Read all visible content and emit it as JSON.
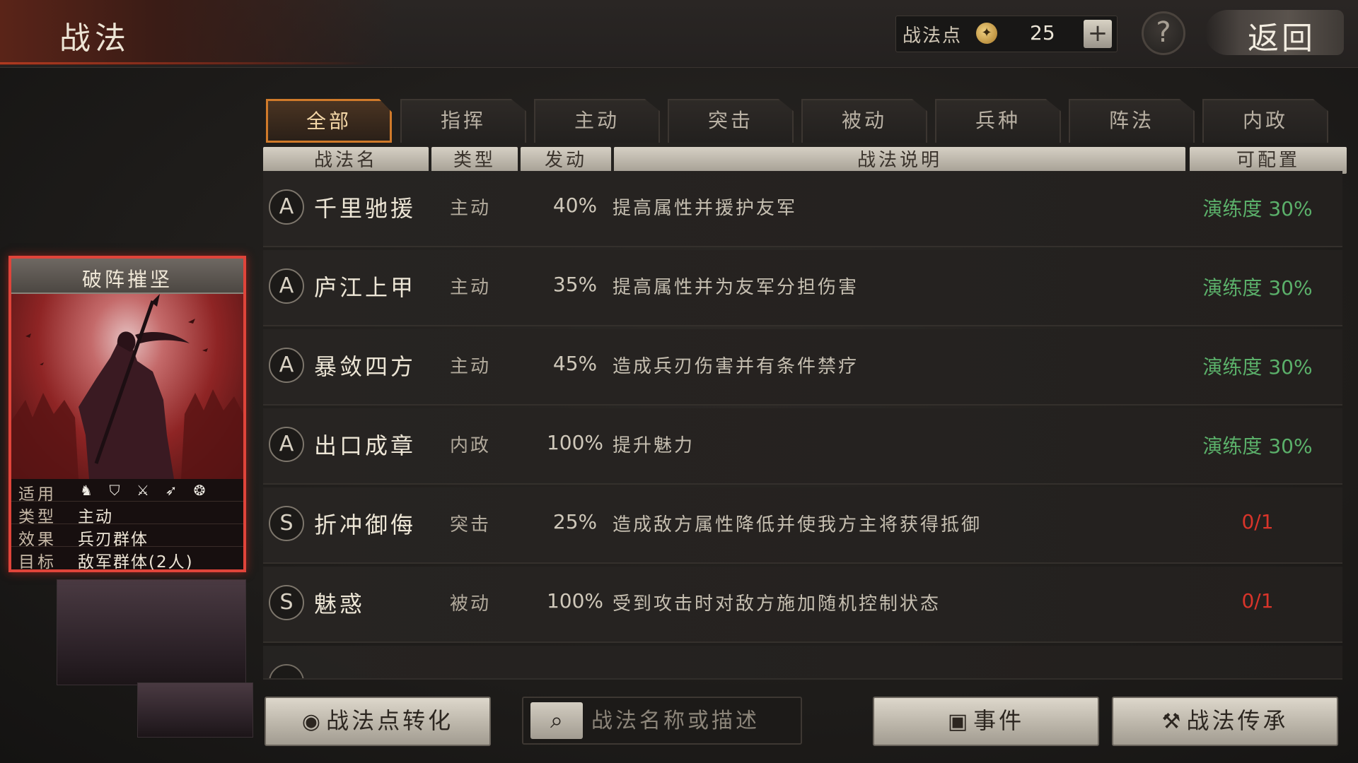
{
  "header": {
    "title": "战法",
    "points_label": "战法点",
    "points_value": "25",
    "plus_label": "+",
    "help_label": "?",
    "back_label": "返回"
  },
  "tabs": [
    {
      "label": "全部",
      "active": true
    },
    {
      "label": "指挥",
      "active": false
    },
    {
      "label": "主动",
      "active": false
    },
    {
      "label": "突击",
      "active": false
    },
    {
      "label": "被动",
      "active": false
    },
    {
      "label": "兵种",
      "active": false
    },
    {
      "label": "阵法",
      "active": false
    },
    {
      "label": "内政",
      "active": false
    }
  ],
  "columns": {
    "name": "战法名",
    "type": "类型",
    "rate": "发动",
    "desc": "战法说明",
    "config": "可配置"
  },
  "skills": [
    {
      "grade": "A",
      "name": "千里驰援",
      "type": "主动",
      "rate": "40%",
      "desc": "提高属性并援护友军",
      "status": "演练度 30%",
      "status_kind": "ok"
    },
    {
      "grade": "A",
      "name": "庐江上甲",
      "type": "主动",
      "rate": "35%",
      "desc": "提高属性并为友军分担伤害",
      "status": "演练度 30%",
      "status_kind": "ok"
    },
    {
      "grade": "A",
      "name": "暴敛四方",
      "type": "主动",
      "rate": "45%",
      "desc": "造成兵刃伤害并有条件禁疗",
      "status": "演练度 30%",
      "status_kind": "ok"
    },
    {
      "grade": "A",
      "name": "出口成章",
      "type": "内政",
      "rate": "100%",
      "desc": "提升魅力",
      "status": "演练度 30%",
      "status_kind": "ok"
    },
    {
      "grade": "S",
      "name": "折冲御侮",
      "type": "突击",
      "rate": "25%",
      "desc": "造成敌方属性降低并使我方主将获得抵御",
      "status": "0/1",
      "status_kind": "no"
    },
    {
      "grade": "S",
      "name": "魅惑",
      "type": "被动",
      "rate": "100%",
      "desc": "受到攻击时对敌方施加随机控制状态",
      "status": "0/1",
      "status_kind": "no"
    }
  ],
  "preview_card": {
    "title": "破阵摧坚",
    "applies_label": "适用",
    "troop_icons": [
      "cavalry-icon",
      "shield-icon",
      "crossed-swords-icon",
      "archer-icon",
      "siege-icon"
    ],
    "type_label": "类型",
    "type_value": "主动",
    "effect_label": "效果",
    "effect_value": "兵刃群体",
    "target_label": "目标",
    "target_value": "敌军群体(2人)"
  },
  "bottom": {
    "convert_label": "战法点转化",
    "search_placeholder": "战法名称或描述",
    "events_label": "事件",
    "inherit_label": "战法传承"
  },
  "colors": {
    "accent_tab": "#d07a2a",
    "status_ok": "#5bb06a",
    "status_no": "#d8342a",
    "card_border": "#e0443a"
  }
}
